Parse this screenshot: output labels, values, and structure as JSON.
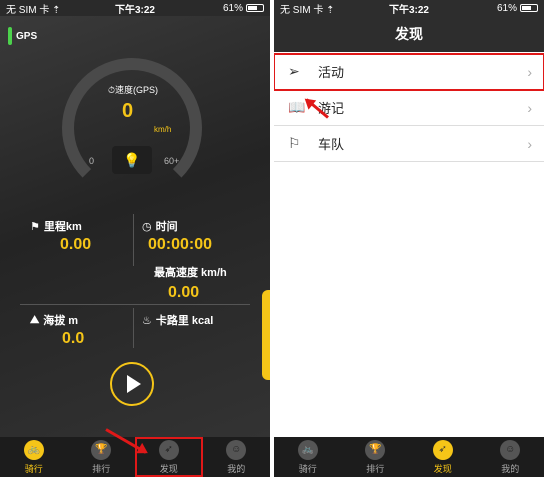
{
  "left": {
    "status": {
      "carrier": "无 SIM 卡 ⇡",
      "time": "下午3:22",
      "battery": "61%"
    },
    "gps_label": "GPS",
    "speed": {
      "label": "速度(GPS)",
      "value": "0",
      "unit": "km/h",
      "min": "0",
      "max": "60+"
    },
    "stats": {
      "distance_label": "里程km",
      "distance_value": "0.00",
      "time_label": "时间",
      "time_value": "00:00:00",
      "max_speed_label": "最高速度 km/h",
      "max_speed_value": "0.00",
      "altitude_label": "海拔 m",
      "altitude_value": "0.0",
      "calorie_label": "卡路里 kcal"
    },
    "tabs": [
      "骑行",
      "排行",
      "发现",
      "我的"
    ]
  },
  "right": {
    "status": {
      "carrier": "无 SIM 卡 ⇡",
      "time": "下午3:22",
      "battery": "61%"
    },
    "title": "发现",
    "rows": [
      {
        "label": "活动",
        "icon": "send-icon"
      },
      {
        "label": "游记",
        "icon": "book-icon"
      },
      {
        "label": "车队",
        "icon": "flag-icon"
      }
    ],
    "tabs": [
      "骑行",
      "排行",
      "发现",
      "我的"
    ]
  },
  "colors": {
    "accent": "#f5c518",
    "highlight": "#e01818",
    "gps": "#4cd24c"
  }
}
